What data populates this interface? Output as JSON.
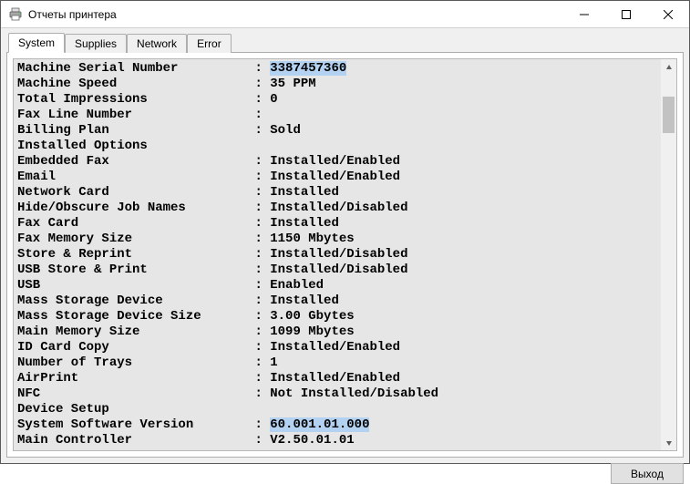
{
  "window": {
    "title": "Отчеты принтера"
  },
  "tabs": {
    "system": "System",
    "supplies": "Supplies",
    "network": "Network",
    "error": "Error"
  },
  "report": {
    "rows": [
      {
        "label": "Machine Serial Number",
        "value": "3387457360",
        "hl": true
      },
      {
        "label": "Machine Speed",
        "value": "35 PPM"
      },
      {
        "label": "Total Impressions",
        "value": "0"
      },
      {
        "label": "Fax Line Number",
        "value": ""
      },
      {
        "label": "Billing Plan",
        "value": "Sold"
      },
      {
        "label": "Installed Options",
        "value": null
      },
      {
        "label": "Embedded Fax",
        "value": "Installed/Enabled"
      },
      {
        "label": "Email",
        "value": "Installed/Enabled"
      },
      {
        "label": "Network Card",
        "value": "Installed"
      },
      {
        "label": "Hide/Obscure Job Names",
        "value": "Installed/Disabled"
      },
      {
        "label": "Fax Card",
        "value": "Installed"
      },
      {
        "label": "Fax Memory Size",
        "value": "1150 Mbytes"
      },
      {
        "label": "Store & Reprint",
        "value": "Installed/Disabled"
      },
      {
        "label": "USB Store & Print",
        "value": "Installed/Disabled"
      },
      {
        "label": "USB",
        "value": "Enabled"
      },
      {
        "label": "Mass Storage Device",
        "value": "Installed"
      },
      {
        "label": "Mass Storage Device Size",
        "value": "3.00 Gbytes"
      },
      {
        "label": "Main Memory Size",
        "value": "1099 Mbytes"
      },
      {
        "label": "ID Card Copy",
        "value": "Installed/Enabled"
      },
      {
        "label": "Number of Trays",
        "value": "1"
      },
      {
        "label": "AirPrint",
        "value": "Installed/Enabled"
      },
      {
        "label": "NFC",
        "value": "Not Installed/Disabled"
      },
      {
        "label": "Device Setup",
        "value": null
      },
      {
        "label": "System Software Version",
        "value": "60.001.01.000",
        "hl": true
      },
      {
        "label": "Main Controller",
        "value": "V2.50.01.01"
      }
    ]
  },
  "footer": {
    "exit": "Выход"
  }
}
